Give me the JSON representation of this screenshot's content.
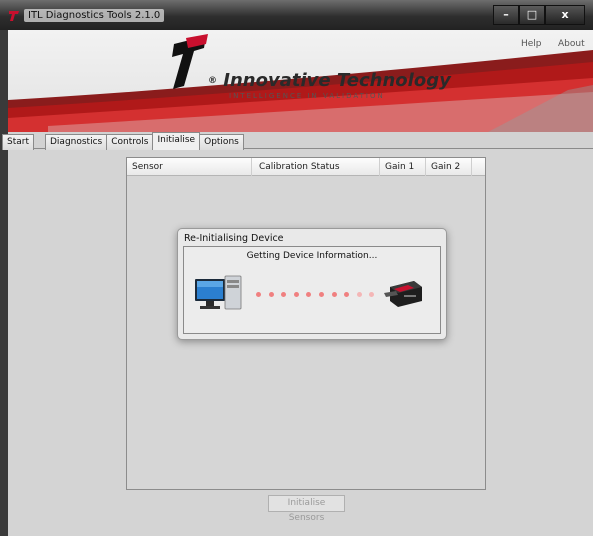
{
  "window": {
    "title": "ITL Diagnostics Tools 2.1.0",
    "controls": {
      "minimize": "–",
      "maximize": "□",
      "close": "x"
    }
  },
  "header": {
    "help_label": "Help",
    "about_label": "About",
    "brand_name": "Innovative Technology",
    "registered_mark": "®",
    "tagline": "INTELLIGENCE IN VALIDATION",
    "brand_color": "#c8102e"
  },
  "tabs": [
    {
      "label": "Start"
    },
    {
      "label": "Diagnostics"
    },
    {
      "label": "Controls"
    },
    {
      "label": "Initialise",
      "active": true
    },
    {
      "label": "Options"
    }
  ],
  "sensor_table": {
    "columns": [
      "Sensor",
      "Calibration Status",
      "Gain 1",
      "Gain 2"
    ],
    "rows": []
  },
  "initialise_button": {
    "label": "Initialise Sensors",
    "enabled": false
  },
  "dialog": {
    "title": "Re-Initialising Device",
    "message": "Getting Device Information...",
    "progress_dot_count": 10
  },
  "icons": {
    "app": "itl-logo-icon",
    "source": "computer-icon",
    "target": "validator-device-icon"
  }
}
